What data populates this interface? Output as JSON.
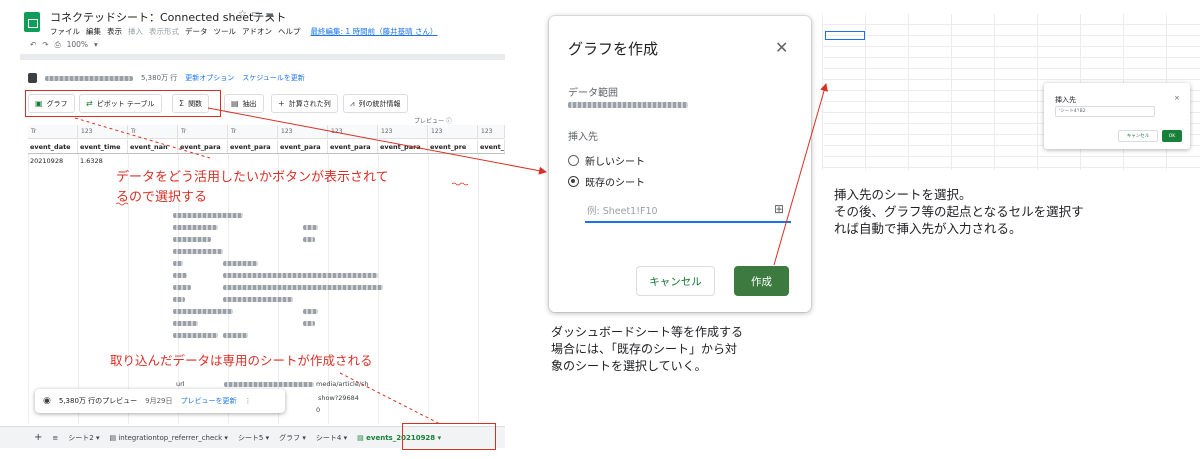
{
  "sheets": {
    "doc_title": "コネクテッドシート：Connected sheetテスト",
    "title_icons": [
      "star-icon",
      "folder-move-icon",
      "cloud-status-icon"
    ],
    "menu": [
      "ファイル",
      "編集",
      "表示",
      "挿入",
      "表示形式",
      "データ",
      "ツール",
      "アドオン",
      "ヘルプ"
    ],
    "last_edit": "最終編集: 1 時間前（藤井基晴 さん）",
    "toolbar": {
      "undo": "↶",
      "redo": "↷",
      "print": "⎙",
      "zoom": "100%"
    },
    "datasource": {
      "rows": "5,380万 行",
      "refresh_options": "更新オプション",
      "schedule": "スケジュールを更新"
    },
    "actions": [
      {
        "icon": "chart-icon",
        "label": "グラフ"
      },
      {
        "icon": "pivot-icon",
        "label": "ピボット テーブル"
      },
      {
        "icon": "sigma-icon",
        "label": "関数"
      },
      {
        "icon": "extract-icon",
        "label": "抽出"
      },
      {
        "icon": "plus-icon",
        "label": "計算された列"
      },
      {
        "icon": "column-stats-icon",
        "label": "列の統計情報"
      }
    ],
    "preview_label": "プレビュー ⓘ",
    "col_types": [
      "Tr",
      "123",
      "Tr",
      "Tr",
      "Tr",
      "123",
      "123",
      "123",
      "123",
      "123"
    ],
    "col_heads": [
      "event_date",
      "event_time",
      "event_nan",
      "event_para",
      "event_para",
      "event_para",
      "event_para",
      "event_para",
      "event_pre",
      "event_"
    ],
    "first_row": [
      "20210928",
      "1.6328"
    ],
    "partial_texts": {
      "url": "url",
      "article": "media/article/sh",
      "show": "show?29684",
      "zero": "0"
    },
    "preview_pill": {
      "label": "5,380万 行のプレビュー",
      "date": "9月29日",
      "refresh": "プレビューを更新",
      "more": "⋮"
    },
    "tabs": [
      {
        "label": "シート2 ▾",
        "active": false
      },
      {
        "label": "integrationtop_referrer_check ▾",
        "active": false
      },
      {
        "label": "シート5 ▾",
        "active": false
      },
      {
        "label": "グラフ ▾",
        "active": false
      },
      {
        "label": "シート4 ▾",
        "active": false
      },
      {
        "label": "events_20210928 ▾",
        "active": true
      }
    ]
  },
  "annotations": {
    "buttons_note_line1": "データをどう活用したいかボタンが表示されて",
    "buttons_note_line2": "るので選択する",
    "sheet_note": "取り込んだデータは専用のシートが作成される",
    "dialog_note": [
      "ダッシュボードシート等を作成する",
      "場合には、「既存のシート」から対",
      "象のシートを選択していく。"
    ],
    "select_note": [
      "挿入先のシートを選択。",
      "その後、グラフ等の起点となるセルを選択す",
      "れば自動で挿入先が入力される。"
    ]
  },
  "dialog": {
    "title": "グラフを作成",
    "close": "✕",
    "range_label": "データ範囲",
    "dest_label": "挿入先",
    "options": [
      {
        "label": "新しいシート",
        "checked": false
      },
      {
        "label": "既存のシート",
        "checked": true
      }
    ],
    "range_placeholder": "例: Sheet1!F10",
    "cancel": "キャンセル",
    "create": "作成"
  },
  "mini_dialog": {
    "title": "挿入先",
    "close": "×",
    "input_value": "'シート4'!B2",
    "cancel": "キャンセル",
    "ok": "OK"
  },
  "colors": {
    "accent_red": "#d93025",
    "sheets_green": "#188038",
    "create_button": "#3c7a3f",
    "link_blue": "#1a73e8"
  }
}
